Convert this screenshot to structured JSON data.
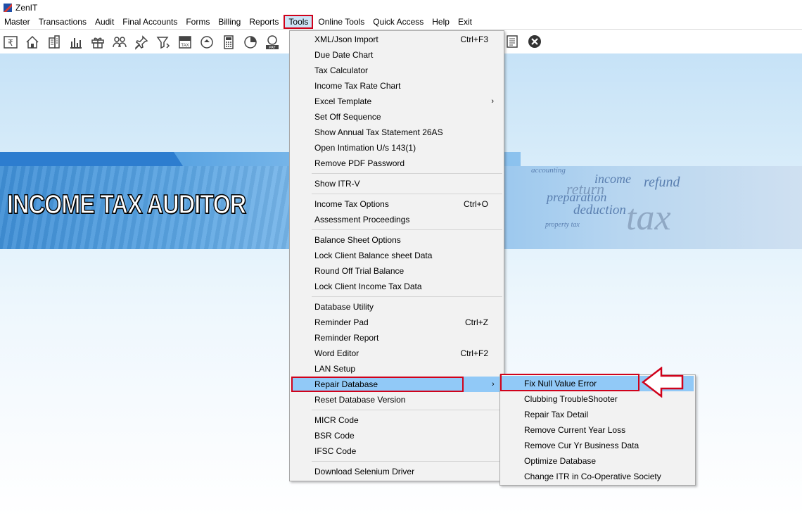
{
  "app": {
    "title": "ZenIT",
    "logo_icon": "zenit-logo-icon"
  },
  "menubar": [
    {
      "label": "Master"
    },
    {
      "label": "Transactions"
    },
    {
      "label": "Audit"
    },
    {
      "label": "Final Accounts"
    },
    {
      "label": "Forms"
    },
    {
      "label": "Billing"
    },
    {
      "label": "Reports"
    },
    {
      "label": "Tools"
    },
    {
      "label": "Online Tools"
    },
    {
      "label": "Quick Access"
    },
    {
      "label": "Help"
    },
    {
      "label": "Exit"
    }
  ],
  "banner": {
    "title": "INCOME TAX AUDITOR"
  },
  "tools_menu": {
    "items": [
      {
        "label": "XML/Json Import",
        "shortcut": "Ctrl+F3"
      },
      {
        "label": "Due Date Chart",
        "shortcut": ""
      },
      {
        "label": "Tax Calculator",
        "shortcut": ""
      },
      {
        "label": "Income Tax Rate Chart",
        "shortcut": ""
      },
      {
        "label": "Excel Template",
        "shortcut": "",
        "submenu": true
      },
      {
        "label": "Set Off Sequence",
        "shortcut": ""
      },
      {
        "label": "Show Annual Tax Statement 26AS",
        "shortcut": ""
      },
      {
        "label": "Open Intimation U/s 143(1)",
        "shortcut": ""
      },
      {
        "label": "Remove PDF Password",
        "shortcut": ""
      },
      {
        "label": "Show ITR-V",
        "shortcut": ""
      },
      {
        "label": "Income Tax Options",
        "shortcut": "Ctrl+O"
      },
      {
        "label": "Assessment Proceedings",
        "shortcut": ""
      },
      {
        "label": "Balance Sheet Options",
        "shortcut": ""
      },
      {
        "label": "Lock Client Balance sheet Data",
        "shortcut": ""
      },
      {
        "label": "Round Off Trial Balance",
        "shortcut": ""
      },
      {
        "label": "Lock Client Income Tax Data",
        "shortcut": ""
      },
      {
        "label": "Database Utility",
        "shortcut": ""
      },
      {
        "label": "Reminder Pad",
        "shortcut": "Ctrl+Z"
      },
      {
        "label": "Reminder Report",
        "shortcut": ""
      },
      {
        "label": "Word Editor",
        "shortcut": "Ctrl+F2"
      },
      {
        "label": "LAN Setup",
        "shortcut": ""
      },
      {
        "label": "Repair Database",
        "shortcut": "",
        "submenu": true
      },
      {
        "label": "Reset Database Version",
        "shortcut": ""
      },
      {
        "label": "MICR Code",
        "shortcut": ""
      },
      {
        "label": "BSR Code",
        "shortcut": ""
      },
      {
        "label": "IFSC Code",
        "shortcut": ""
      },
      {
        "label": "Download Selenium Driver",
        "shortcut": ""
      }
    ]
  },
  "repair_submenu": {
    "items": [
      {
        "label": "Fix Null Value Error"
      },
      {
        "label": "Clubbing TroubleShooter"
      },
      {
        "label": "Repair Tax Detail"
      },
      {
        "label": "Remove Current Year Loss"
      },
      {
        "label": "Remove Cur Yr Business Data"
      },
      {
        "label": "Optimize Database"
      },
      {
        "label": "Change ITR in Co-Operative Society"
      }
    ]
  },
  "colors": {
    "highlight": "#91c9f7",
    "annotation_red": "#d0021b",
    "menu_bg": "#f2f2f2"
  }
}
